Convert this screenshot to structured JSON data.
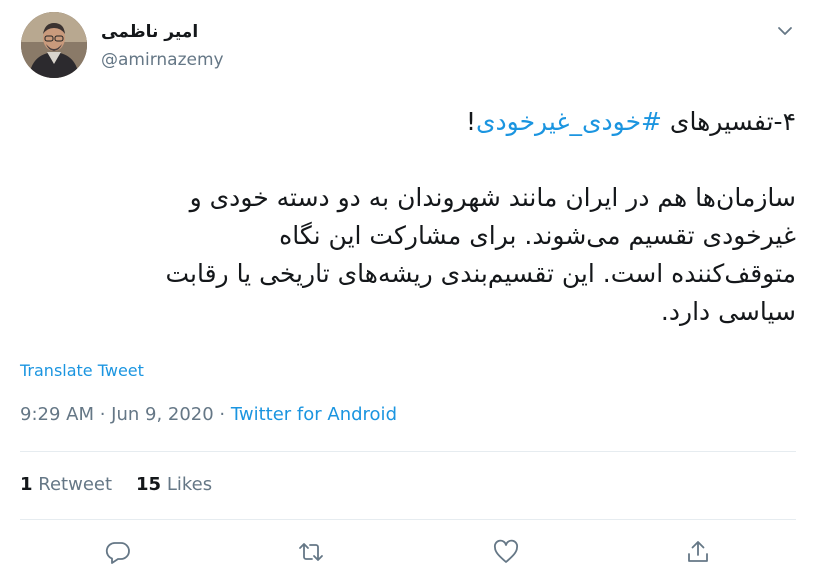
{
  "user": {
    "display_name": "امیر ناظمی",
    "handle": "@amirnazemy"
  },
  "tweet": {
    "prefix": "۴-تفسیرهای ",
    "hashtag": "#خودی_غیرخودی",
    "suffix": "!",
    "line1": "سازمان‌ها هم در ایران مانند شهروندان به دو دسته خودی و",
    "line2": "غیرخودی تقسیم می‌شوند. برای مشارکت این نگاه",
    "line3": "متوقف‌کننده است. این تقسیم‌بندی ریشه‌های تاریخی یا رقابت",
    "line4": "سیاسی دارد."
  },
  "translate_label": "Translate Tweet",
  "meta": {
    "timestamp": "9:29 AM · Jun 9, 2020 · ",
    "source": "Twitter for Android"
  },
  "stats": {
    "retweets_count": "1",
    "retweets_label": "Retweet",
    "likes_count": "15",
    "likes_label": "Likes"
  },
  "icons": {
    "caret": "chevron-down-icon",
    "reply": "reply-icon",
    "retweet": "retweet-icon",
    "like": "heart-icon",
    "share": "share-icon"
  },
  "colors": {
    "link": "#1b95e0",
    "secondary": "#657786",
    "icon": "#657786"
  }
}
